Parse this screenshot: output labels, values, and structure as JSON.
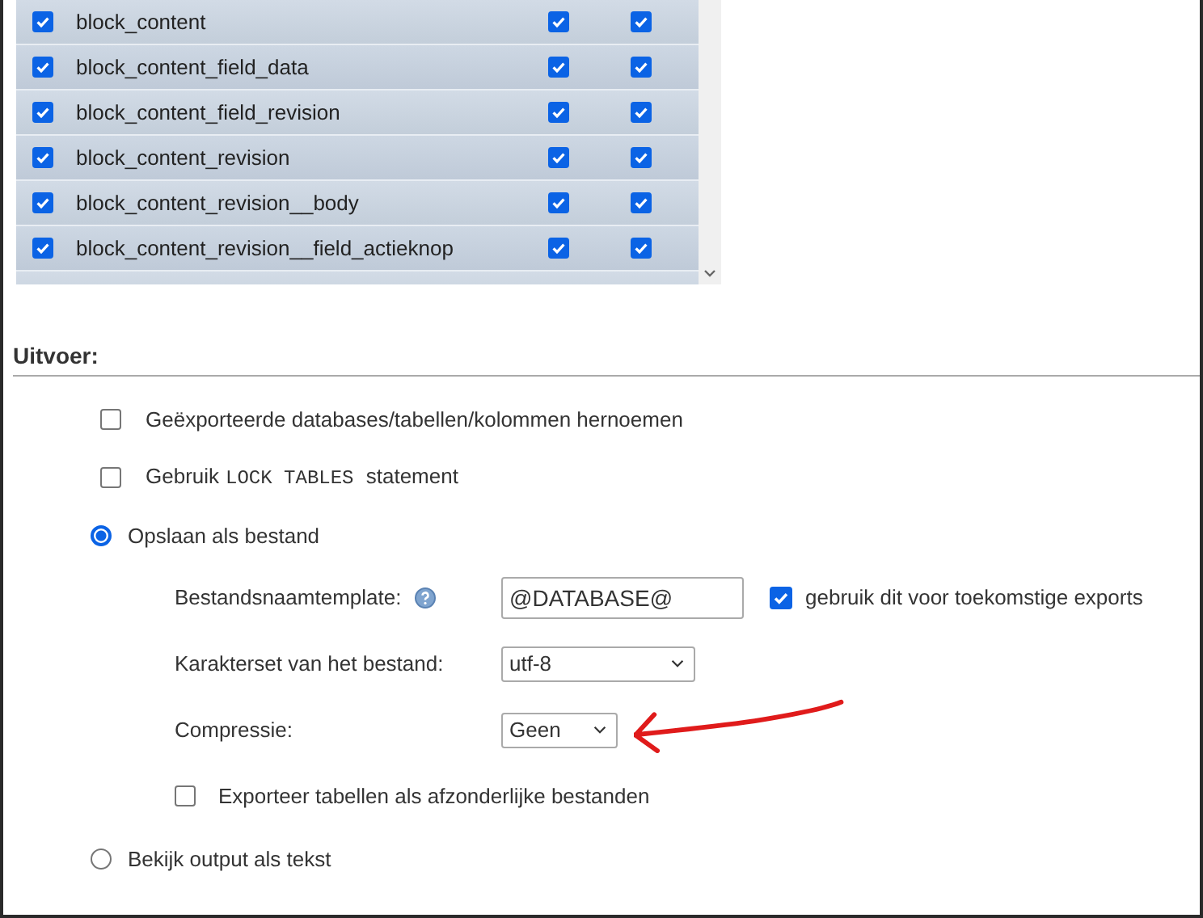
{
  "tables": {
    "rows": [
      {
        "name": "block_content",
        "checked": true,
        "column_2_checked": true,
        "column_3_checked": true
      },
      {
        "name": "block_content_field_data",
        "checked": true,
        "column_2_checked": true,
        "column_3_checked": true
      },
      {
        "name": "block_content_field_revision",
        "checked": true,
        "column_2_checked": true,
        "column_3_checked": true
      },
      {
        "name": "block_content_revision",
        "checked": true,
        "column_2_checked": true,
        "column_3_checked": true
      },
      {
        "name": "block_content_revision__body",
        "checked": true,
        "column_2_checked": true,
        "column_3_checked": true
      },
      {
        "name": "block_content_revision__field_actieknop",
        "checked": true,
        "column_2_checked": true,
        "column_3_checked": true
      }
    ]
  },
  "output": {
    "heading": "Uitvoer:",
    "options": [
      {
        "kind": "checkbox",
        "label": "Geëxporteerde databases/tabellen/kolommen hernoemen",
        "checked": false
      },
      {
        "kind": "checkbox",
        "label": "Gebruik",
        "code": "LOCK TABLES",
        "label_after": "statement",
        "checked": false
      },
      {
        "kind": "radio",
        "label": "Opslaan als bestand",
        "selected": true,
        "settings": {
          "filename_label": "Bestandsnaamtemplate:",
          "filename_value": "@DATABASE@",
          "remember_label": "gebruik dit voor toekomstige exports",
          "remember_checked": true,
          "charset_label": "Karakterset van het bestand:",
          "charset_value": "utf-8",
          "compression_label": "Compressie:",
          "compression_value": "Geen",
          "separate_label": "Exporteer tabellen als afzonderlijke bestanden",
          "separate_checked": false
        }
      },
      {
        "kind": "radio",
        "label": "Bekijk output als tekst",
        "selected": false
      }
    ]
  }
}
